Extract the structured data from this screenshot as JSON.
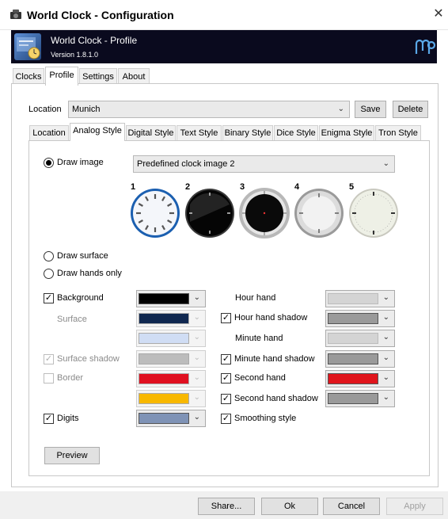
{
  "window": {
    "title": "World Clock - Configuration",
    "close_glyph": "✕"
  },
  "banner": {
    "title": "World Clock - Profile",
    "version": "Version 1.8.1.0",
    "logo_icon": "mp-logo-icon"
  },
  "top_tabs": [
    {
      "label": "Clocks",
      "active": false
    },
    {
      "label": "Profile",
      "active": true
    },
    {
      "label": "Settings",
      "active": false
    },
    {
      "label": "About",
      "active": false
    }
  ],
  "location": {
    "label": "Location",
    "value": "Munich",
    "save_label": "Save",
    "delete_label": "Delete"
  },
  "sub_tabs": [
    {
      "label": "Location",
      "active": false
    },
    {
      "label": "Analog Style",
      "active": true
    },
    {
      "label": "Digital Style",
      "active": false
    },
    {
      "label": "Text Style",
      "active": false
    },
    {
      "label": "Binary Style",
      "active": false
    },
    {
      "label": "Dice Style",
      "active": false
    },
    {
      "label": "Enigma Style",
      "active": false
    },
    {
      "label": "Tron Style",
      "active": false
    }
  ],
  "analog": {
    "draw_image": {
      "label": "Draw image",
      "checked": true
    },
    "image_select": {
      "value": "Predefined clock image 2"
    },
    "clock_images": [
      {
        "number": "1",
        "style": "white-blue-ring"
      },
      {
        "number": "2",
        "style": "black-glossy"
      },
      {
        "number": "3",
        "style": "black-silver-bezel"
      },
      {
        "number": "4",
        "style": "silver-metal"
      },
      {
        "number": "5",
        "style": "cream-numbered"
      }
    ],
    "draw_surface": {
      "label": "Draw surface",
      "checked": false
    },
    "draw_hands_only": {
      "label": "Draw hands only",
      "checked": false
    },
    "left_options": [
      {
        "label": "Background",
        "checked": true,
        "disabled": false,
        "has_checkbox": true,
        "color": "#000000"
      },
      {
        "label": "Surface",
        "checked": false,
        "disabled": true,
        "has_checkbox": false,
        "color": "#102850"
      },
      {
        "label": "",
        "checked": false,
        "disabled": true,
        "has_checkbox": false,
        "color": "#d0ddf4"
      },
      {
        "label": "Surface shadow",
        "checked": true,
        "disabled": true,
        "has_checkbox": true,
        "color": "#bcbcbc"
      },
      {
        "label": "Border",
        "checked": false,
        "disabled": true,
        "has_checkbox": true,
        "color": "#e01020"
      },
      {
        "label": "",
        "checked": false,
        "disabled": true,
        "has_checkbox": false,
        "color": "#f8b800"
      },
      {
        "label": "Digits",
        "checked": true,
        "disabled": false,
        "has_checkbox": true,
        "color": "#7f93b6"
      }
    ],
    "right_options": [
      {
        "label": "Hour hand",
        "checked": false,
        "has_checkbox": false,
        "color": "#d4d4d4"
      },
      {
        "label": "Hour hand shadow",
        "checked": true,
        "has_checkbox": true,
        "color": "#9a9a9a"
      },
      {
        "label": "Minute hand",
        "checked": false,
        "has_checkbox": false,
        "color": "#d4d4d4"
      },
      {
        "label": "Minute hand shadow",
        "checked": true,
        "has_checkbox": true,
        "color": "#9a9a9a"
      },
      {
        "label": "Second hand",
        "checked": true,
        "has_checkbox": true,
        "color": "#e0151c"
      },
      {
        "label": "Second hand shadow",
        "checked": true,
        "has_checkbox": true,
        "color": "#9a9a9a"
      },
      {
        "label": "Smoothing style",
        "checked": true,
        "has_checkbox": true,
        "color": ""
      }
    ],
    "preview_label": "Preview"
  },
  "footer": {
    "share_label": "Share...",
    "ok_label": "Ok",
    "cancel_label": "Cancel",
    "apply_label": "Apply"
  }
}
